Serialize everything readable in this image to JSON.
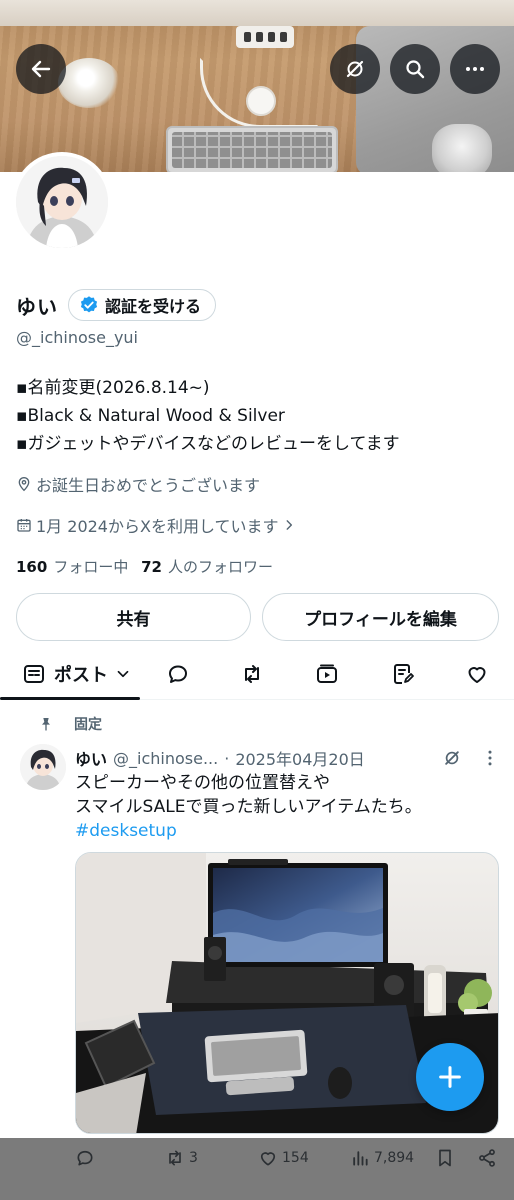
{
  "header": {
    "back_icon": "arrow-left-icon",
    "grok_icon": "grok-icon",
    "search_icon": "search-icon",
    "more_icon": "more-horizontal-icon"
  },
  "profile": {
    "display_name": "ゆい",
    "verify_label": "認証を受ける",
    "handle": "@_ichinose_yui",
    "bio_lines": [
      "▪名前変更(2026.8.14~)",
      "▪Black & Natural Wood & Silver",
      "▪ガジェットやデバイスなどのレビューをしてます"
    ],
    "birthday_text": "お誕生日おめでとうございます",
    "joined_text": "1月 2024からXを利用しています",
    "following_count": "160",
    "following_label": "フォロー中",
    "followers_count": "72",
    "followers_label": "人のフォロワー",
    "share_label": "共有",
    "edit_profile_label": "プロフィールを編集",
    "accent_color": "#1d9bf0"
  },
  "tabs": {
    "active_label": "ポスト",
    "icons": [
      "reply-icon",
      "repost-icon",
      "video-icon",
      "article-icon",
      "like-icon"
    ]
  },
  "post": {
    "pinned_label": "固定",
    "author_name": "ゆい",
    "author_handle": "@_ichinose...",
    "separator": "·",
    "date": "2025年04月20日",
    "text_line1": "スピーカーやその他の位置替えや",
    "text_line2": "スマイルSALEで買った新しいアイテムたち。",
    "hashtag": "#desksetup",
    "stats": {
      "reposts": "3",
      "likes": "154",
      "views": "7,894"
    }
  },
  "fab": {
    "icon": "plus-icon"
  }
}
